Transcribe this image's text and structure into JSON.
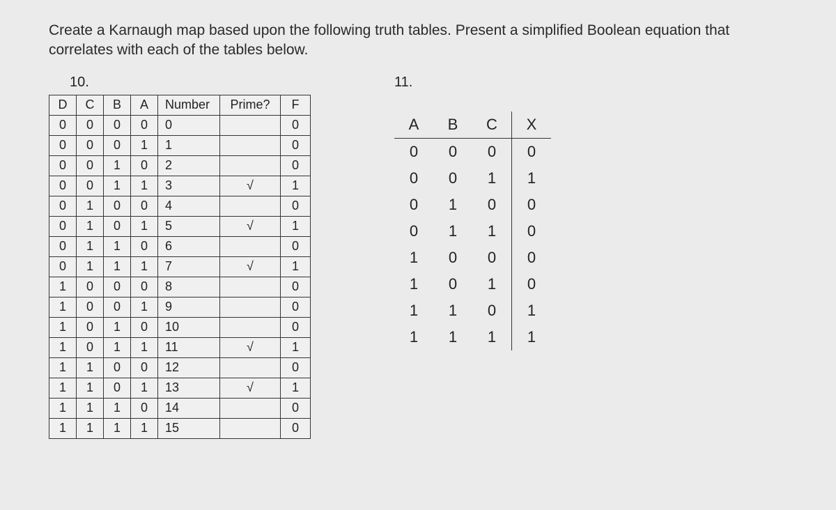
{
  "prompt": "Create a Karnaugh map based upon the following truth tables. Present a simplified Boolean equation that correlates with each of the tables below.",
  "q10": {
    "label": "10.",
    "headers": [
      "D",
      "C",
      "B",
      "A",
      "Number",
      "Prime?",
      "F"
    ],
    "rows": [
      {
        "D": "0",
        "C": "0",
        "B": "0",
        "A": "0",
        "Number": "0",
        "Prime": "",
        "F": "0"
      },
      {
        "D": "0",
        "C": "0",
        "B": "0",
        "A": "1",
        "Number": "1",
        "Prime": "",
        "F": "0"
      },
      {
        "D": "0",
        "C": "0",
        "B": "1",
        "A": "0",
        "Number": "2",
        "Prime": "",
        "F": "0"
      },
      {
        "D": "0",
        "C": "0",
        "B": "1",
        "A": "1",
        "Number": "3",
        "Prime": "√",
        "F": "1"
      },
      {
        "D": "0",
        "C": "1",
        "B": "0",
        "A": "0",
        "Number": "4",
        "Prime": "",
        "F": "0"
      },
      {
        "D": "0",
        "C": "1",
        "B": "0",
        "A": "1",
        "Number": "5",
        "Prime": "√",
        "F": "1"
      },
      {
        "D": "0",
        "C": "1",
        "B": "1",
        "A": "0",
        "Number": "6",
        "Prime": "",
        "F": "0"
      },
      {
        "D": "0",
        "C": "1",
        "B": "1",
        "A": "1",
        "Number": "7",
        "Prime": "√",
        "F": "1"
      },
      {
        "D": "1",
        "C": "0",
        "B": "0",
        "A": "0",
        "Number": "8",
        "Prime": "",
        "F": "0"
      },
      {
        "D": "1",
        "C": "0",
        "B": "0",
        "A": "1",
        "Number": "9",
        "Prime": "",
        "F": "0"
      },
      {
        "D": "1",
        "C": "0",
        "B": "1",
        "A": "0",
        "Number": "10",
        "Prime": "",
        "F": "0"
      },
      {
        "D": "1",
        "C": "0",
        "B": "1",
        "A": "1",
        "Number": "11",
        "Prime": "√",
        "F": "1"
      },
      {
        "D": "1",
        "C": "1",
        "B": "0",
        "A": "0",
        "Number": "12",
        "Prime": "",
        "F": "0"
      },
      {
        "D": "1",
        "C": "1",
        "B": "0",
        "A": "1",
        "Number": "13",
        "Prime": "√",
        "F": "1"
      },
      {
        "D": "1",
        "C": "1",
        "B": "1",
        "A": "0",
        "Number": "14",
        "Prime": "",
        "F": "0"
      },
      {
        "D": "1",
        "C": "1",
        "B": "1",
        "A": "1",
        "Number": "15",
        "Prime": "",
        "F": "0"
      }
    ]
  },
  "q11": {
    "label": "11.",
    "headers": [
      "A",
      "B",
      "C",
      "X"
    ],
    "rows": [
      {
        "A": "0",
        "B": "0",
        "C": "0",
        "X": "0"
      },
      {
        "A": "0",
        "B": "0",
        "C": "1",
        "X": "1"
      },
      {
        "A": "0",
        "B": "1",
        "C": "0",
        "X": "0"
      },
      {
        "A": "0",
        "B": "1",
        "C": "1",
        "X": "0"
      },
      {
        "A": "1",
        "B": "0",
        "C": "0",
        "X": "0"
      },
      {
        "A": "1",
        "B": "0",
        "C": "1",
        "X": "0"
      },
      {
        "A": "1",
        "B": "1",
        "C": "0",
        "X": "1"
      },
      {
        "A": "1",
        "B": "1",
        "C": "1",
        "X": "1"
      }
    ]
  }
}
